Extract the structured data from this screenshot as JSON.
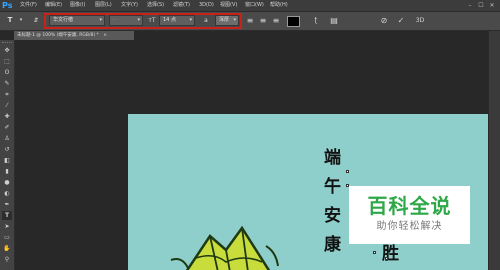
{
  "app": {
    "logo": "Ps"
  },
  "menus": [
    "文件(F)",
    "编辑(E)",
    "图像(I)",
    "图层(L)",
    "文字(Y)",
    "选择(S)",
    "滤镜(T)",
    "3D(D)",
    "视图(V)",
    "窗口(W)",
    "帮助(H)"
  ],
  "window_controls": [
    "–",
    "☐",
    "✕"
  ],
  "options": {
    "font_family": "华文行楷",
    "font_style": "-",
    "font_size": "14 点",
    "aa_label": "a",
    "aa_mode": "浑厚",
    "commit_icon": "✓",
    "cancel_icon": "⊘",
    "threed_label": "3D"
  },
  "document": {
    "tab_title": "未标题-1 @ 100% (端午安康, RGB/8) *",
    "close_icon": "×"
  },
  "canvas": {
    "background_color": "#8ecfcb",
    "vertical_text": [
      "端",
      "午",
      "安",
      "康"
    ],
    "partial_text": "胜"
  },
  "watermark": {
    "title": "百科全说",
    "subtitle": "助你轻松解决",
    "color": "#2fa848"
  },
  "icons": {
    "tool_preset": "type-tool-icon",
    "orientation": "text-orientation-icon",
    "align": [
      "align-left-icon",
      "align-center-icon",
      "align-right-icon"
    ],
    "warp": "warp-text-icon",
    "panels": "character-panel-icon"
  }
}
